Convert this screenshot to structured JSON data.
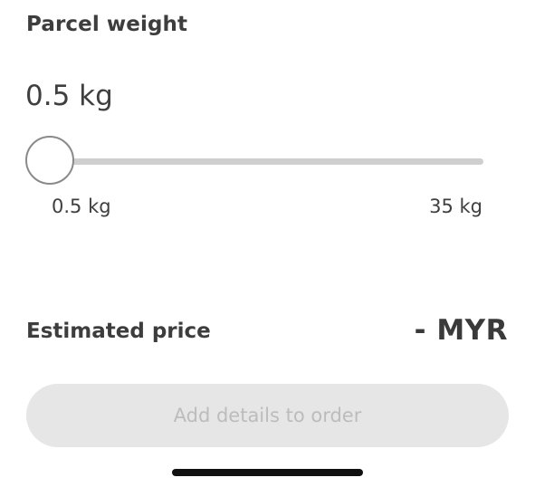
{
  "parcel_weight": {
    "title": "Parcel weight",
    "value_text": "0.5 kg",
    "slider": {
      "value": 0.5,
      "min": 0.5,
      "max": 35,
      "min_label": "0.5 kg",
      "max_label": "35 kg"
    }
  },
  "estimate": {
    "label": "Estimated price",
    "value": "- MYR"
  },
  "cta": {
    "label": "Add details to order",
    "enabled": false
  },
  "colors": {
    "text": "#3d3d3d",
    "track": "#cfcfcf",
    "thumb_border": "#8a8a8a",
    "button_bg_disabled": "#e6e6e6",
    "button_text_disabled": "#bcbcbc",
    "home_indicator": "#111111"
  }
}
